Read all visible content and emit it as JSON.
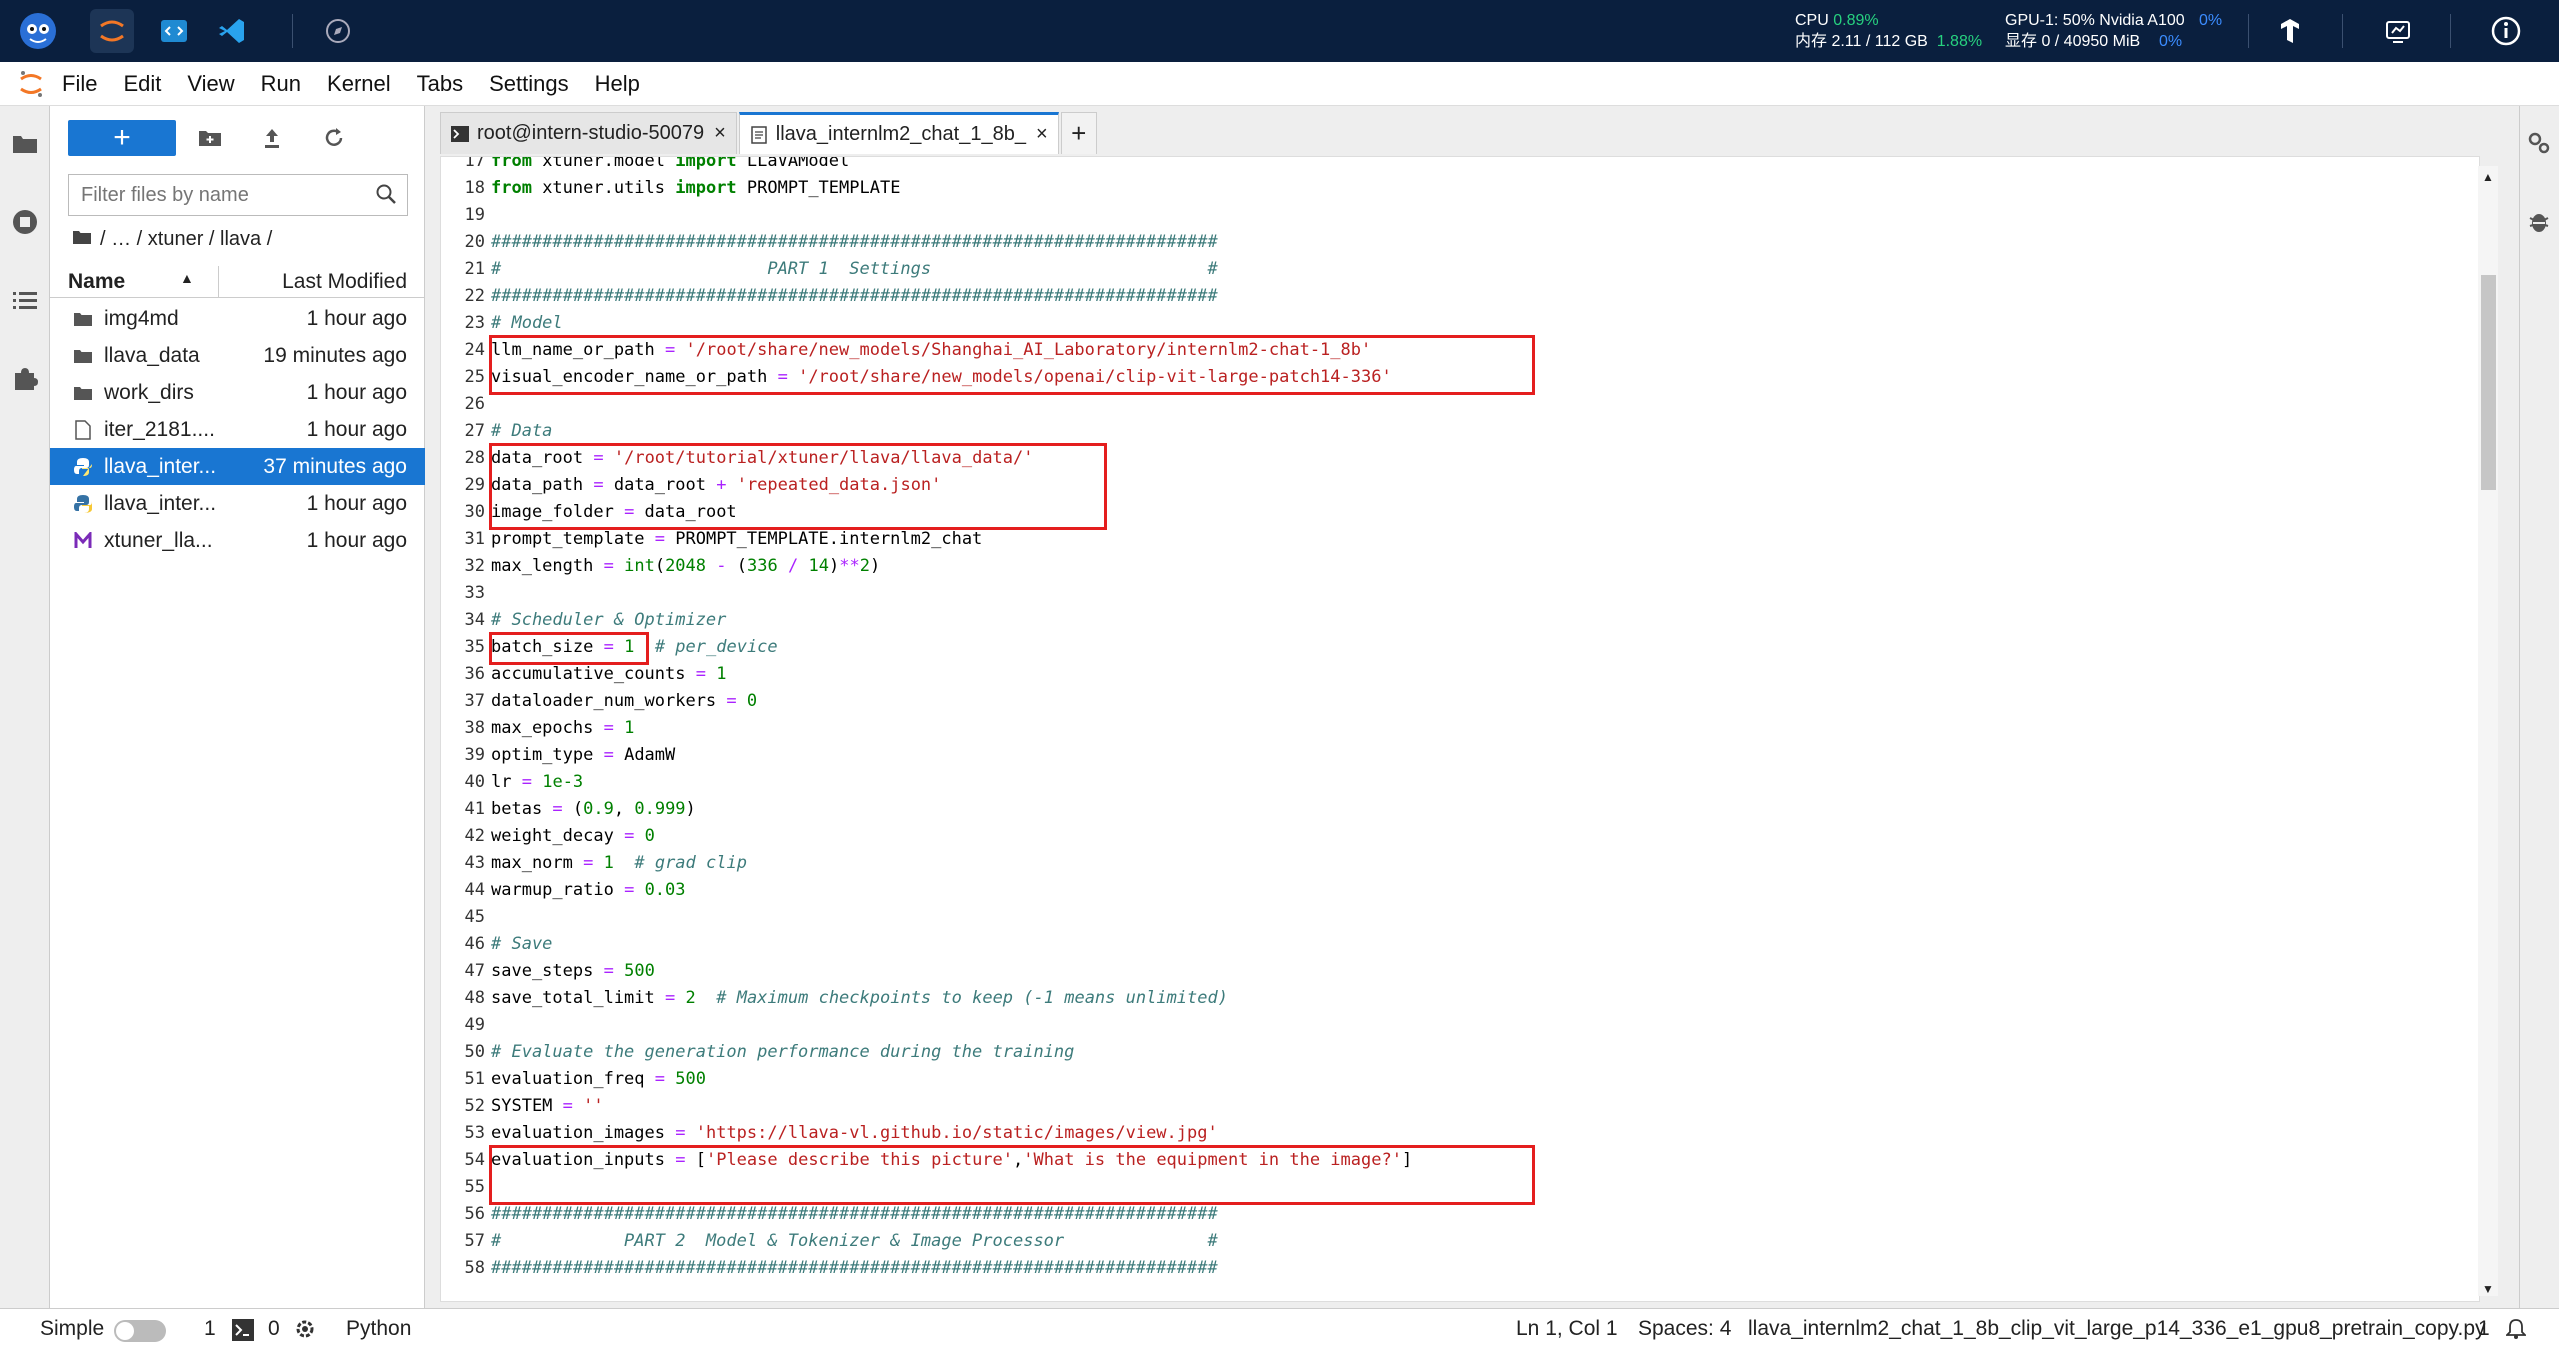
{
  "topbar": {
    "cpu_label": "CPU",
    "cpu_value": "0.89%",
    "mem_label": "内存 2.11 / 112 GB",
    "mem_value": "1.88%",
    "gpu_label": "GPU-1: 50% Nvidia A100",
    "gpu_value": "0%",
    "vram_label": "显存 0 / 40950 MiB",
    "vram_value": "0%"
  },
  "menu": [
    "File",
    "Edit",
    "View",
    "Run",
    "Kernel",
    "Tabs",
    "Settings",
    "Help"
  ],
  "filebrowser": {
    "new_label": "+",
    "filter_placeholder": "Filter files by name",
    "breadcrumb": "/  …  / xtuner / llava /",
    "col_name": "Name",
    "col_modified": "Last Modified",
    "files": [
      {
        "name": "img4md",
        "modified": "1 hour ago",
        "icon": "folder-icon"
      },
      {
        "name": "llava_data",
        "modified": "19 minutes ago",
        "icon": "folder-icon"
      },
      {
        "name": "work_dirs",
        "modified": "1 hour ago",
        "icon": "folder-icon"
      },
      {
        "name": "iter_2181....",
        "modified": "1 hour ago",
        "icon": "file-icon"
      },
      {
        "name": "llava_inter...",
        "modified": "37 minutes ago",
        "icon": "python-icon"
      },
      {
        "name": "llava_inter...",
        "modified": "1 hour ago",
        "icon": "python-icon"
      },
      {
        "name": "xtuner_lla...",
        "modified": "1 hour ago",
        "icon": "markdown-icon"
      }
    ]
  },
  "tabs": [
    {
      "label": "root@intern-studio-50079",
      "close": "×"
    },
    {
      "label": "llava_internlm2_chat_1_8b_",
      "close": "×"
    }
  ],
  "add_tab": "+",
  "code_lines": [
    {
      "n": "17",
      "t": "from xtuner.model import LLaVAModel"
    },
    {
      "n": "18",
      "t": "from xtuner.utils import PROMPT_TEMPLATE"
    },
    {
      "n": "19",
      "t": ""
    },
    {
      "n": "20",
      "t": "#######################################################################"
    },
    {
      "n": "21",
      "t": "#                          PART 1  Settings                           #"
    },
    {
      "n": "22",
      "t": "#######################################################################"
    },
    {
      "n": "23",
      "t": "# Model"
    },
    {
      "n": "24",
      "t": "llm_name_or_path = '/root/share/new_models/Shanghai_AI_Laboratory/internlm2-chat-1_8b'"
    },
    {
      "n": "25",
      "t": "visual_encoder_name_or_path = '/root/share/new_models/openai/clip-vit-large-patch14-336'"
    },
    {
      "n": "26",
      "t": ""
    },
    {
      "n": "27",
      "t": "# Data"
    },
    {
      "n": "28",
      "t": "data_root = '/root/tutorial/xtuner/llava/llava_data/'"
    },
    {
      "n": "29",
      "t": "data_path = data_root + 'repeated_data.json'"
    },
    {
      "n": "30",
      "t": "image_folder = data_root"
    },
    {
      "n": "31",
      "t": "prompt_template = PROMPT_TEMPLATE.internlm2_chat"
    },
    {
      "n": "32",
      "t": "max_length = int(2048 - (336 / 14)**2)"
    },
    {
      "n": "33",
      "t": ""
    },
    {
      "n": "34",
      "t": "# Scheduler & Optimizer"
    },
    {
      "n": "35",
      "t": "batch_size = 1  # per_device"
    },
    {
      "n": "36",
      "t": "accumulative_counts = 1"
    },
    {
      "n": "37",
      "t": "dataloader_num_workers = 0"
    },
    {
      "n": "38",
      "t": "max_epochs = 1"
    },
    {
      "n": "39",
      "t": "optim_type = AdamW"
    },
    {
      "n": "40",
      "t": "lr = 1e-3"
    },
    {
      "n": "41",
      "t": "betas = (0.9, 0.999)"
    },
    {
      "n": "42",
      "t": "weight_decay = 0"
    },
    {
      "n": "43",
      "t": "max_norm = 1  # grad clip"
    },
    {
      "n": "44",
      "t": "warmup_ratio = 0.03"
    },
    {
      "n": "45",
      "t": ""
    },
    {
      "n": "46",
      "t": "# Save"
    },
    {
      "n": "47",
      "t": "save_steps = 500"
    },
    {
      "n": "48",
      "t": "save_total_limit = 2  # Maximum checkpoints to keep (-1 means unlimited)"
    },
    {
      "n": "49",
      "t": ""
    },
    {
      "n": "50",
      "t": "# Evaluate the generation performance during the training"
    },
    {
      "n": "51",
      "t": "evaluation_freq = 500"
    },
    {
      "n": "52",
      "t": "SYSTEM = ''"
    },
    {
      "n": "53",
      "t": "evaluation_images = 'https://llava-vl.github.io/static/images/view.jpg'"
    },
    {
      "n": "54",
      "t": "evaluation_inputs = ['Please describe this picture','What is the equipment in the image?']"
    },
    {
      "n": "55",
      "t": ""
    },
    {
      "n": "56",
      "t": "#######################################################################"
    },
    {
      "n": "57",
      "t": "#            PART 2  Model & Tokenizer & Image Processor              #"
    },
    {
      "n": "58",
      "t": "#######################################################################"
    }
  ],
  "statusbar": {
    "mode": "Simple",
    "count1": "1",
    "count2": "0",
    "kernel": "Python",
    "position": "Ln 1, Col 1",
    "spaces": "Spaces: 4",
    "filename": "llava_internlm2_chat_1_8b_clip_vit_large_p14_336_e1_gpu8_pretrain_copy.py",
    "page": "1"
  },
  "colors": {
    "accent": "#1976d2",
    "highlight": "#e41e1e",
    "topbar": "#0a1f3e"
  }
}
